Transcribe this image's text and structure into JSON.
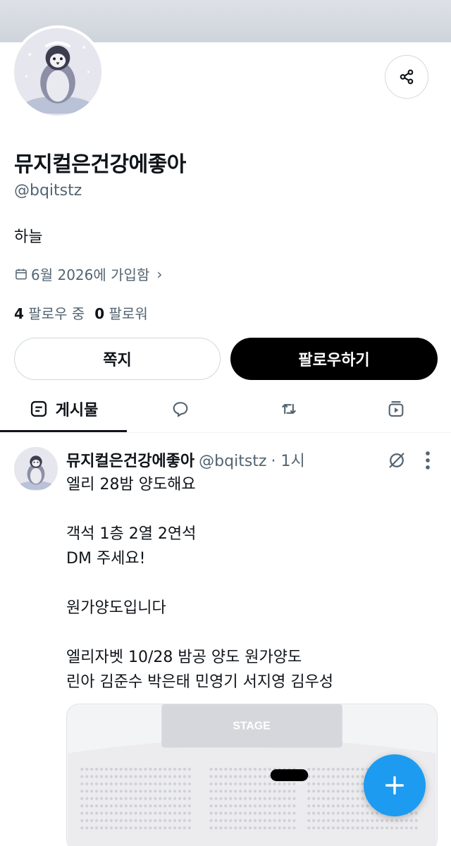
{
  "profile": {
    "display_name": "뮤지컬은건강에좋아",
    "handle": "@bqitstz",
    "bio": "하늘",
    "joined": "6월 2026에 가입함",
    "following_count": "4",
    "following_label": "팔로우 중",
    "followers_count": "0",
    "followers_label": "팔로워"
  },
  "buttons": {
    "dm": "쪽지",
    "follow": "팔로우하기"
  },
  "tabs": {
    "posts": "게시물"
  },
  "tweet": {
    "name": "뮤지컬은건강에좋아",
    "handle": "@bqitstz",
    "time": "· 1시",
    "lines": [
      "엘리 28밤 양도해요",
      "",
      "객석 1층 2열 2연석",
      "DM 주세요!",
      "",
      "원가양도입니다",
      "",
      "엘리자벳 10/28 밤공 양도 원가양도",
      "린아 김준수 박은태 민영기 서지영 김우성"
    ],
    "image": {
      "stage_label": "STAGE"
    }
  },
  "colors": {
    "accent": "#1d9bf0",
    "text": "#0f1419",
    "secondary": "#536471"
  },
  "icons": {
    "share": "share-icon",
    "calendar": "calendar-icon",
    "posts_tab": "posts-icon",
    "replies_tab": "reply-icon",
    "reposts_tab": "repost-icon",
    "media_tab": "media-icon",
    "grok": "grok-icon",
    "more": "more-icon",
    "compose": "plus-icon"
  }
}
